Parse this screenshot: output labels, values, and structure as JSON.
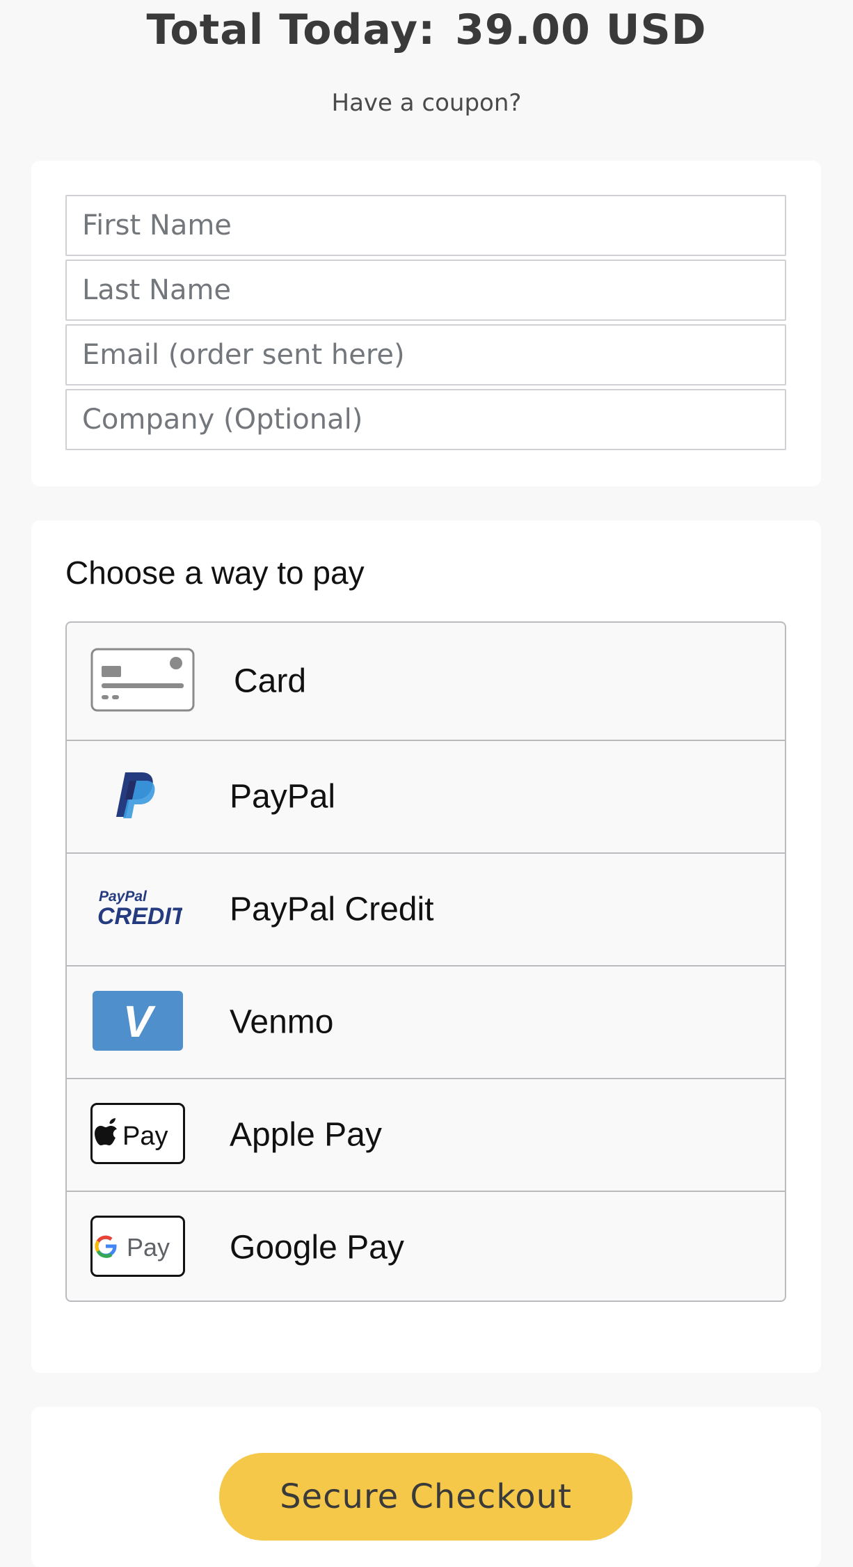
{
  "header": {
    "total_label": "Total Today:",
    "total_amount": "39.00 USD",
    "coupon_link": "Have a coupon?"
  },
  "form": {
    "first_name_placeholder": "First Name",
    "last_name_placeholder": "Last Name",
    "email_placeholder": "Email (order sent here)",
    "company_placeholder": "Company (Optional)"
  },
  "payment": {
    "title": "Choose a way to pay",
    "methods": [
      {
        "label": "Card",
        "icon": "credit-card-icon"
      },
      {
        "label": "PayPal",
        "icon": "paypal-icon"
      },
      {
        "label": "PayPal Credit",
        "icon": "paypal-credit-icon"
      },
      {
        "label": "Venmo",
        "icon": "venmo-icon"
      },
      {
        "label": "Apple Pay",
        "icon": "apple-pay-icon"
      },
      {
        "label": "Google Pay",
        "icon": "google-pay-icon"
      }
    ],
    "logo_text": {
      "paypal_credit_small": "PayPal",
      "paypal_credit_big": "CREDIT",
      "venmo": "V",
      "apple_pay": "Pay",
      "google_pay": "Pay"
    }
  },
  "checkout": {
    "button_label": "Secure Checkout"
  },
  "colors": {
    "background": "#f8f8f9",
    "checkout_button": "#f5c84a",
    "venmo_blue": "#4f8fcc",
    "paypal_dark": "#253b80",
    "paypal_light": "#3b9ae0"
  }
}
